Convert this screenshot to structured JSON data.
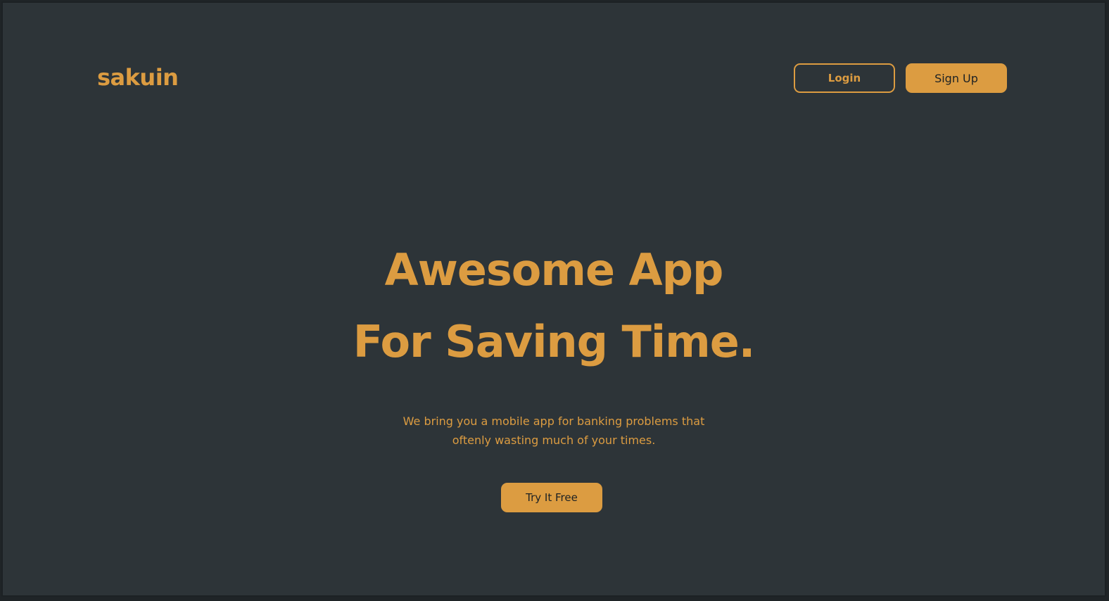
{
  "header": {
    "logo": "sakuin",
    "login_label": "Login",
    "signup_label": "Sign Up"
  },
  "hero": {
    "title_line1": "Awesome App",
    "title_line2": "For Saving Time.",
    "subtitle_line1": "We bring you a mobile app for banking problems that",
    "subtitle_line2": "oftenly wasting much of your times.",
    "cta_label": "Try It Free"
  },
  "colors": {
    "background": "#2d3438",
    "accent": "#dc9c41",
    "dark_text": "#1c2124"
  }
}
